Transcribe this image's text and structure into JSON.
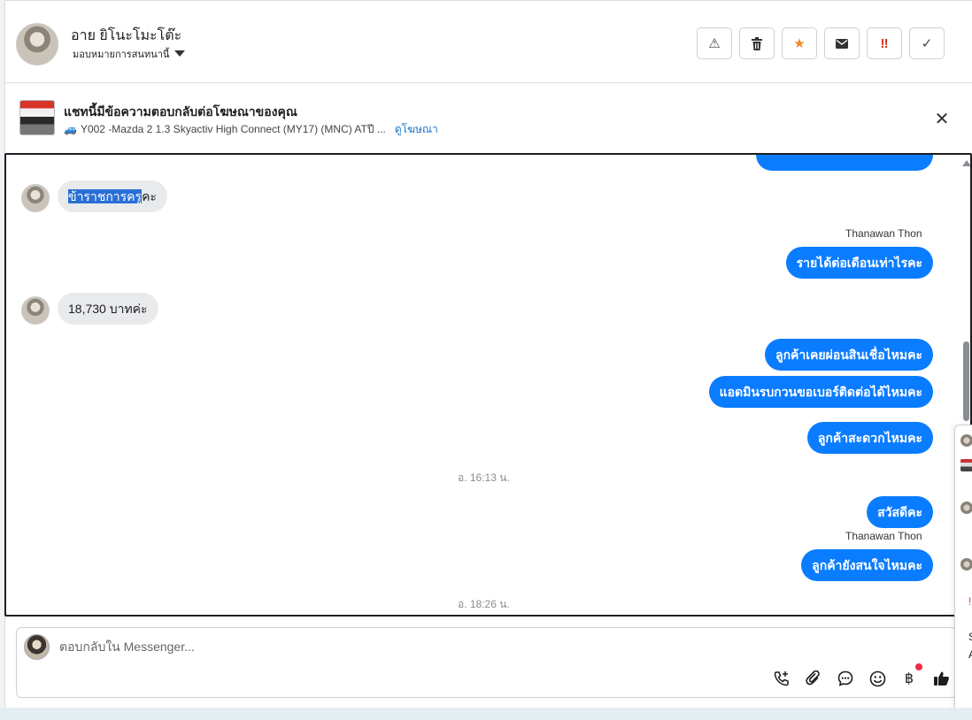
{
  "header": {
    "contact_name": "อาย ยิโนะโมะโต๊ะ",
    "assign_label": "มอบหมายการสนทนานี้",
    "actions": [
      {
        "name": "spam-button",
        "glyph": "⚠"
      },
      {
        "name": "delete-button",
        "glyph": "🗑"
      },
      {
        "name": "star-button",
        "glyph": "★"
      },
      {
        "name": "mark-unread-button",
        "glyph": "✉"
      },
      {
        "name": "follow-up-button",
        "glyph": "‼"
      },
      {
        "name": "done-button",
        "glyph": "✓"
      }
    ]
  },
  "ad_banner": {
    "title": "แชทนี้มีข้อความตอบกลับต่อโฆษณาของคุณ",
    "car_icon": "🚙",
    "ad_name": "Y002 -Mazda 2 1.3 Skyactiv High Connect (MY17) (MNC) ATปี ...",
    "view_ad_link": "ดูโฆษณา",
    "close_glyph": "✕"
  },
  "thread": {
    "messages": [
      {
        "dir": "in",
        "highlight": "ข้าราชการครู",
        "rest": "คะ"
      },
      {
        "dir": "out",
        "sender": "Thanawan Thon",
        "text": "รายได้ต่อเดือนเท่าไรคะ"
      },
      {
        "dir": "in",
        "text": "18,730 บาทค่ะ"
      },
      {
        "dir": "out",
        "text": "ลูกค้าเคยผ่อนสินเชื่อไหมคะ"
      },
      {
        "dir": "out",
        "text": "แอดมินรบกวนขอเบอร์ติดต่อได้ไหมคะ"
      },
      {
        "dir": "out",
        "text": "ลูกค้าสะดวกไหมคะ"
      },
      {
        "dir": "time",
        "text": "อ. 16:13 น."
      },
      {
        "dir": "out",
        "text": "สวัสดีคะ"
      },
      {
        "dir": "out",
        "sender": "Thanawan Thon",
        "text": "ลูกค้ายังสนใจไหมคะ"
      },
      {
        "dir": "time",
        "text": "อ. 18:26 น."
      }
    ]
  },
  "composer": {
    "placeholder": "ตอบกลับใน Messenger...",
    "tools": [
      "phone-plus-icon",
      "attachment-icon",
      "saved-reply-icon",
      "emoji-icon",
      "baht-payment-icon",
      "like-icon"
    ],
    "baht_glyph": "฿"
  },
  "side_panel": {
    "mark_glyph": "!",
    "letters": [
      "S",
      "A"
    ]
  },
  "colors": {
    "outgoing_bubble": "#0a7cff",
    "incoming_bubble": "#e9eaec",
    "selection_highlight": "#2a6fd6",
    "link": "#1a73c9",
    "notification_dot": "#f02849"
  }
}
